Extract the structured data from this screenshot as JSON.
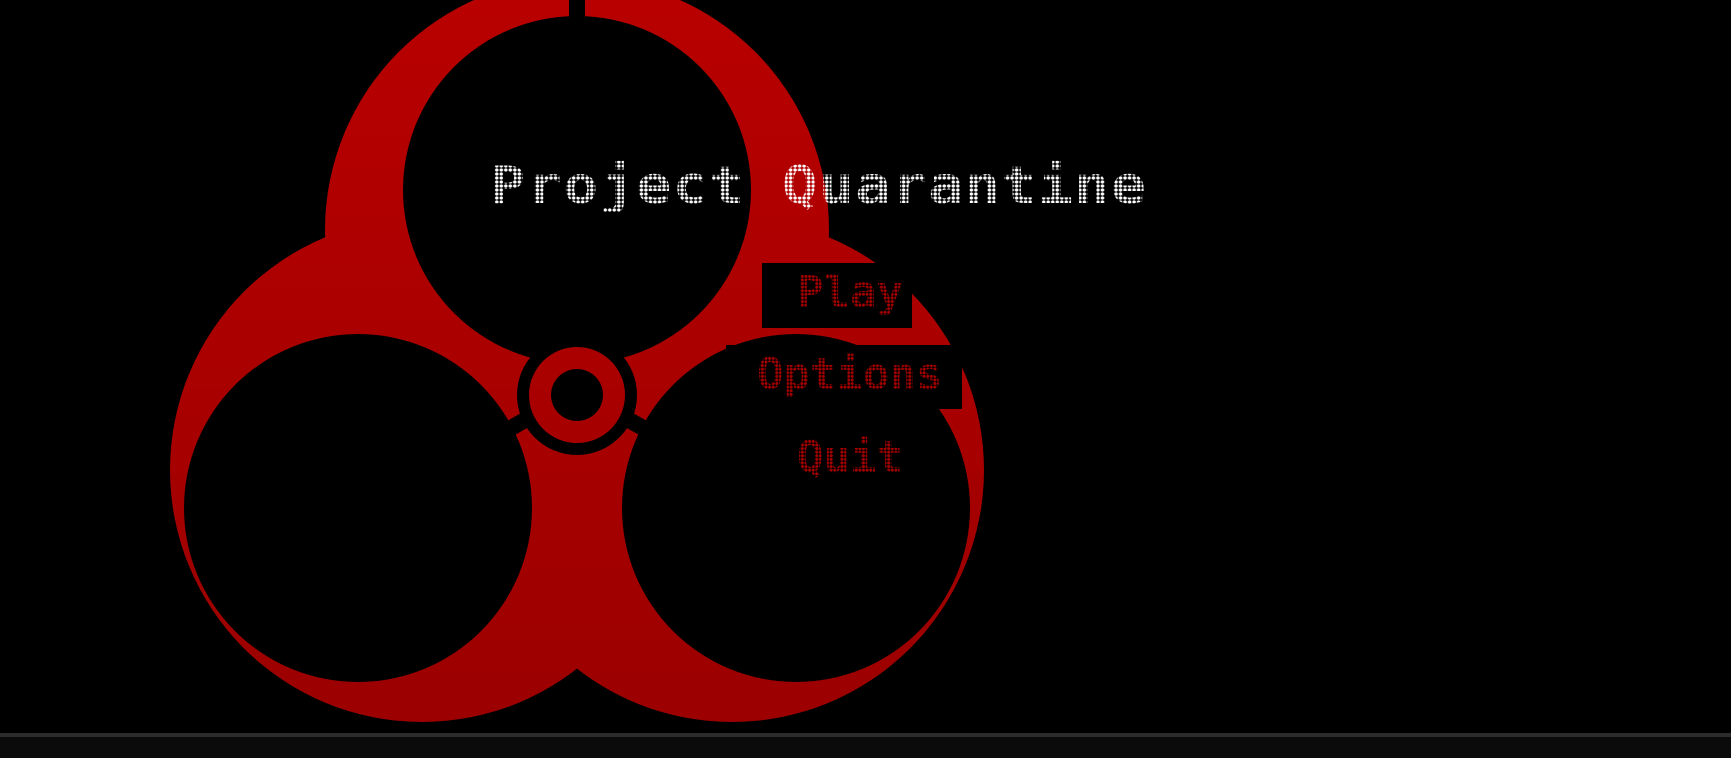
{
  "title": "Project Quarantine",
  "menu": {
    "play_label": "Play",
    "options_label": "Options",
    "quit_label": "Quit"
  },
  "icons": {
    "emblem": "biohazard-icon"
  },
  "colors": {
    "background": "#000000",
    "emblem": "#b20000",
    "title": "#ffffff",
    "menu_text": "#a80000"
  }
}
